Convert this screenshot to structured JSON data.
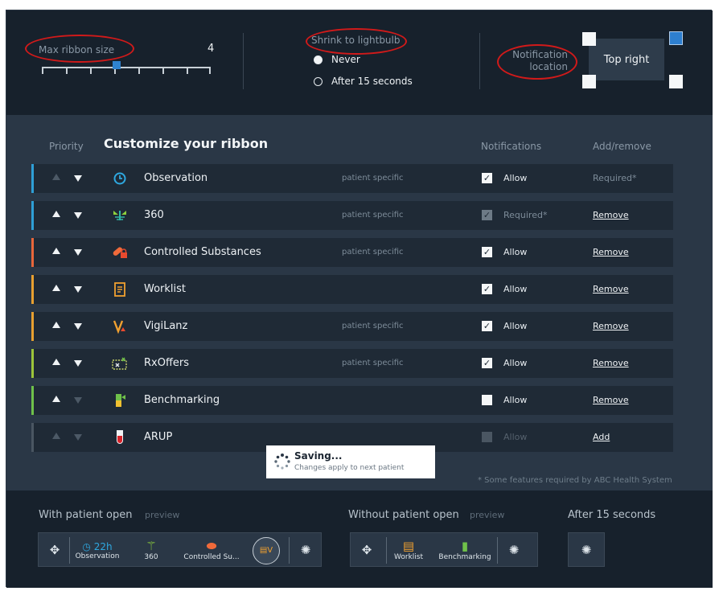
{
  "settings": {
    "max_ribbon_label": "Max ribbon size",
    "max_ribbon_value": "4",
    "max_ribbon_fraction": 0.45,
    "shrink_label": "Shrink to lightbulb",
    "shrink_options": [
      "Never",
      "After 15 seconds"
    ],
    "shrink_selected": "Never",
    "notification_label_line1": "Notification",
    "notification_label_line2": "location",
    "location_button": "Top right",
    "location_selected": "top-right"
  },
  "list": {
    "col_priority": "Priority",
    "title": "Customize your ribbon",
    "col_notifications": "Notifications",
    "col_addremove": "Add/remove",
    "rows": [
      {
        "name": "Observation",
        "tag": "patient specific",
        "notify": "Allow",
        "action": "Required*",
        "accent": "#2e9fd6",
        "icon": "clock-icon"
      },
      {
        "name": "360",
        "tag": "patient specific",
        "notify": "Required*",
        "action": "Remove",
        "accent": "#2e9fd6",
        "icon": "360-icon"
      },
      {
        "name": "Controlled Substances",
        "tag": "patient specific",
        "notify": "Allow",
        "action": "Remove",
        "accent": "#e8663a",
        "icon": "pill-lock-icon"
      },
      {
        "name": "Worklist",
        "tag": "",
        "notify": "Allow",
        "action": "Remove",
        "accent": "#e8a030",
        "icon": "worklist-icon"
      },
      {
        "name": "VigiLanz",
        "tag": "patient specific",
        "notify": "Allow",
        "action": "Remove",
        "accent": "#e8a030",
        "icon": "vigilanz-icon"
      },
      {
        "name": "RxOffers",
        "tag": "patient specific",
        "notify": "Allow",
        "action": "Remove",
        "accent": "#9cc43a",
        "icon": "rxoffers-icon"
      },
      {
        "name": "Benchmarking",
        "tag": "",
        "notify": "Allow",
        "action": "Remove",
        "accent": "#6fc14a",
        "icon": "benchmarking-icon"
      },
      {
        "name": "ARUP",
        "tag": "",
        "notify": "Allow",
        "action": "Add",
        "accent": "#4a5662",
        "icon": "test-tube-icon"
      }
    ],
    "toast_title": "Saving...",
    "toast_sub": "Changes apply to next patient",
    "footnote": "* Some features required by ABC Health System"
  },
  "preview": {
    "with_label": "With patient open",
    "with_preview": "preview",
    "without_label": "Without patient open",
    "without_preview": "preview",
    "after_label": "After 15 seconds",
    "obs_time": "22h",
    "items_with": [
      "Observation",
      "360",
      "Controlled Su..."
    ],
    "items_without": [
      "Worklist",
      "Benchmarking"
    ]
  },
  "colors": {
    "accent_blue": "#2d7fd0",
    "highlight_ring": "#d11a1a"
  }
}
